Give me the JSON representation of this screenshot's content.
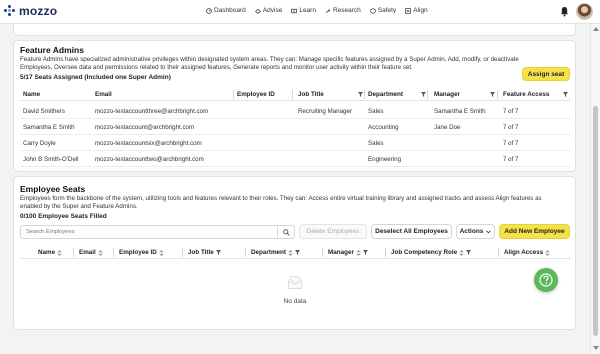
{
  "app": {
    "logo_text": "mozzo"
  },
  "nav": {
    "items": [
      {
        "label": "Dashboard",
        "icon": "dashboard-icon"
      },
      {
        "label": "Advise",
        "icon": "advise-icon"
      },
      {
        "label": "Learn",
        "icon": "learn-icon"
      },
      {
        "label": "Research",
        "icon": "research-icon"
      },
      {
        "label": "Safety",
        "icon": "safety-icon"
      },
      {
        "label": "Align",
        "icon": "align-icon"
      }
    ]
  },
  "feature_admins": {
    "title": "Feature Admins",
    "description": "Feature Admins have specialized administrative privileges within designated system areas. They can: Manage specific features assigned by a Super Admin, Add, modify, or deactivate Employees, Oversee data and permissions related to their assigned features, Generate reports and monitor user activity within their feature set.",
    "seats_assigned": "5/17 Seats Assigned (Included one Super Admin)",
    "assign_button": "Assign seat",
    "columns": [
      "Name",
      "Email",
      "Employee ID",
      "Job Title",
      "Department",
      "Manager",
      "Feature Access"
    ],
    "rows": [
      {
        "name": "David Smithers",
        "email": "mozzo-testaccountthree@archbright.com",
        "employee_id": "",
        "job_title": "Recruiting Manager",
        "department": "Sales",
        "manager": "Samantha E Smith",
        "access": "7 of 7"
      },
      {
        "name": "Samantha E Smith",
        "email": "mozzo-testaccount@archbright.com",
        "employee_id": "",
        "job_title": "",
        "department": "Accounting",
        "manager": "Jane Doe",
        "access": "7 of 7"
      },
      {
        "name": "Carry Doyle",
        "email": "mozzo-testaccountsix@archbright.com",
        "employee_id": "",
        "job_title": "",
        "department": "Sales",
        "manager": "",
        "access": "7 of 7"
      },
      {
        "name": "John B Smith-O'Dell",
        "email": "mozzo-testaccounttwo@archbright.com",
        "employee_id": "",
        "job_title": "",
        "department": "Engineering",
        "manager": "",
        "access": "7 of 7"
      }
    ]
  },
  "employee_seats": {
    "title": "Employee Seats",
    "description": "Employees form the backbone of the system, utilizing tools and features relevant to their roles. They can: Access entire virtual training library and assigned tracks and assess Align features as enabled by the Super and Feature Admins.",
    "seats_filled": "0/100 Employee Seats Filled",
    "search_placeholder": "Search Employees",
    "delete_button": "Delete Employees",
    "deselect_button": "Deselect All Employees",
    "actions_button": "Actions",
    "add_button": "Add New Employee",
    "columns": [
      "Name",
      "Email",
      "Employee ID",
      "Job Title",
      "Department",
      "Manager",
      "Job Competency Role",
      "Align Access"
    ],
    "empty_text": "No data"
  },
  "colors": {
    "accent_yellow": "#f5e24a",
    "help_green": "#5cb85c",
    "brand_navy": "#1d2b5b"
  }
}
